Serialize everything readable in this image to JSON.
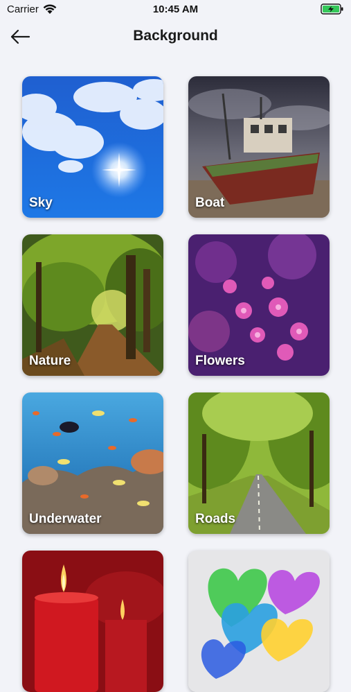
{
  "status_bar": {
    "carrier": "Carrier",
    "time": "10:45 AM",
    "wifi_icon": "wifi-icon",
    "battery_icon": "battery-charging-icon",
    "battery_color": "#34c759"
  },
  "header": {
    "title": "Background",
    "back_icon": "arrow-left-icon"
  },
  "backgrounds": [
    {
      "label": "Sky"
    },
    {
      "label": "Boat"
    },
    {
      "label": "Nature"
    },
    {
      "label": "Flowers"
    },
    {
      "label": "Underwater"
    },
    {
      "label": "Roads"
    },
    {
      "label": ""
    },
    {
      "label": ""
    }
  ],
  "colors": {
    "page_background": "#f2f3f8",
    "label_text": "#ffffff"
  }
}
